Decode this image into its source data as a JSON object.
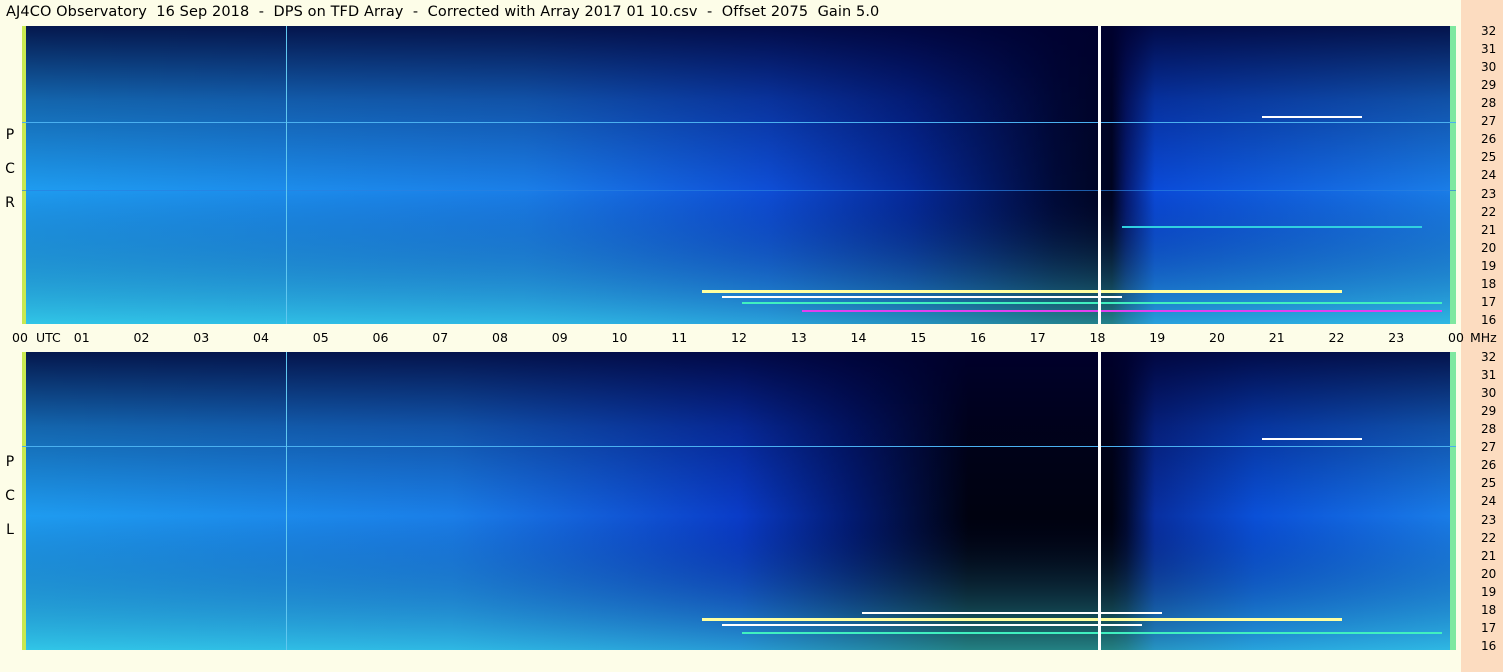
{
  "header": {
    "title": "AJ4CO Observatory  16 Sep 2018  -  DPS on TFD Array  -  Corrected with Array 2017 01 10.csv  -  Offset 2075  Gain 5.0"
  },
  "panels": {
    "top": {
      "polarization": [
        "R",
        "C",
        "P"
      ]
    },
    "bottom": {
      "polarization": [
        "L",
        "C",
        "P"
      ]
    }
  },
  "time_axis": {
    "unit_label": "UTC",
    "freq_unit_label": "MHz",
    "hours": [
      "00",
      "01",
      "02",
      "03",
      "04",
      "05",
      "06",
      "07",
      "08",
      "09",
      "10",
      "11",
      "12",
      "13",
      "14",
      "15",
      "16",
      "17",
      "18",
      "19",
      "20",
      "21",
      "22",
      "23",
      "00"
    ]
  },
  "freq_axis": {
    "ticks": [
      "32",
      "31",
      "30",
      "29",
      "28",
      "27",
      "26",
      "25",
      "24",
      "23",
      "22",
      "21",
      "20",
      "19",
      "18",
      "17",
      "16"
    ]
  },
  "colors": {
    "background": "#fdfde8",
    "right_strip": "#fcdcc0",
    "spectrogram_dark": "#000010",
    "spectrogram_blue": "#0a4ee8",
    "spectrogram_cyan": "#22c4f4"
  },
  "chart_data": {
    "type": "heatmap",
    "title": "AJ4CO Observatory  16 Sep 2018  -  DPS on TFD Array  -  Corrected with Array 2017 01 10.csv  -  Offset 2075  Gain 5.0",
    "xlabel": "UTC",
    "ylabel": "MHz",
    "xlim": [
      0,
      24
    ],
    "ylim": [
      16,
      32
    ],
    "series": [
      {
        "name": "R C P"
      },
      {
        "name": "L C P"
      }
    ]
  }
}
